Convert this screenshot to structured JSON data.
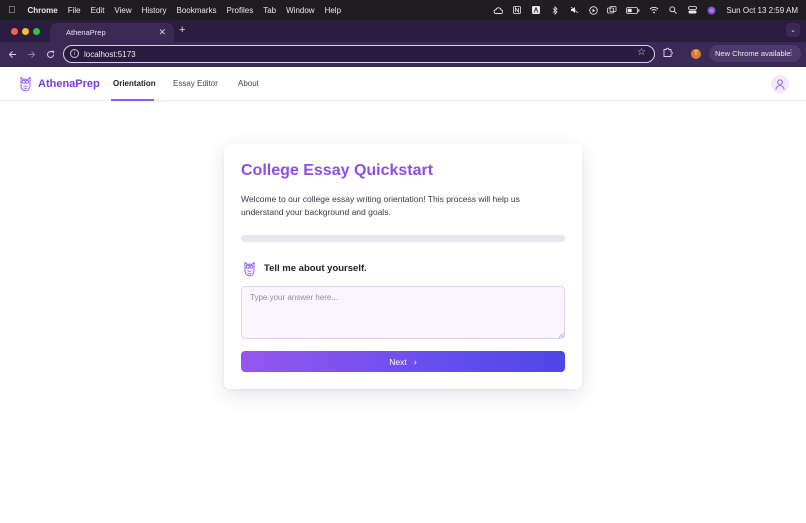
{
  "menubar": {
    "app_name": "Chrome",
    "items": [
      "File",
      "Edit",
      "View",
      "History",
      "Bookmarks",
      "Profiles",
      "Tab",
      "Window",
      "Help"
    ],
    "clock": "Sun Oct 13  2:59 AM"
  },
  "browser": {
    "tab_title": "AthenaPrep",
    "url": "localhost:5173",
    "profile_initial": "T",
    "update_label": "New Chrome available"
  },
  "app": {
    "brand": "AthenaPrep",
    "nav": [
      "Orientation",
      "Essay Editor",
      "About"
    ],
    "active_nav": "Orientation",
    "brand_color": "#7c3aed"
  },
  "card": {
    "title": "College Essay Quickstart",
    "intro": "Welcome to our college essay writing orientation! This process will help us understand your background and goals.",
    "progress_fraction": 0.0,
    "question": "Tell me about yourself.",
    "answer_placeholder": "Type your answer here...",
    "answer_value": "",
    "next_label": "Next"
  }
}
